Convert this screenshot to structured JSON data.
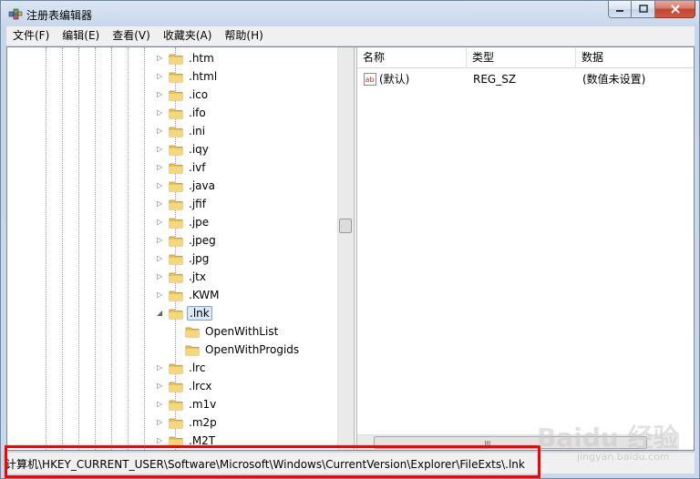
{
  "window": {
    "title": "注册表编辑器"
  },
  "menu": [
    "文件(F)",
    "编辑(E)",
    "查看(V)",
    "收藏夹(A)",
    "帮助(H)"
  ],
  "tree": {
    "items": [
      {
        "label": ".htm",
        "level": 0,
        "expander": "▷"
      },
      {
        "label": ".html",
        "level": 0,
        "expander": "▷"
      },
      {
        "label": ".ico",
        "level": 0,
        "expander": "▷"
      },
      {
        "label": ".ifo",
        "level": 0,
        "expander": "▷"
      },
      {
        "label": ".ini",
        "level": 0,
        "expander": "▷"
      },
      {
        "label": ".iqy",
        "level": 0,
        "expander": "▷"
      },
      {
        "label": ".ivf",
        "level": 0,
        "expander": "▷"
      },
      {
        "label": ".java",
        "level": 0,
        "expander": "▷"
      },
      {
        "label": ".jfif",
        "level": 0,
        "expander": "▷"
      },
      {
        "label": ".jpe",
        "level": 0,
        "expander": "▷"
      },
      {
        "label": ".jpeg",
        "level": 0,
        "expander": "▷"
      },
      {
        "label": ".jpg",
        "level": 0,
        "expander": "▷"
      },
      {
        "label": ".jtx",
        "level": 0,
        "expander": "▷"
      },
      {
        "label": ".KWM",
        "level": 0,
        "expander": "▷"
      },
      {
        "label": ".lnk",
        "level": 0,
        "expander": "◢",
        "selected": true
      },
      {
        "label": "OpenWithList",
        "level": 1,
        "expander": ""
      },
      {
        "label": "OpenWithProgids",
        "level": 1,
        "expander": ""
      },
      {
        "label": ".lrc",
        "level": 0,
        "expander": "▷"
      },
      {
        "label": ".lrcx",
        "level": 0,
        "expander": "▷"
      },
      {
        "label": ".m1v",
        "level": 0,
        "expander": "▷"
      },
      {
        "label": ".m2p",
        "level": 0,
        "expander": "▷"
      },
      {
        "label": ".M2T",
        "level": 0,
        "expander": "▷"
      }
    ]
  },
  "list": {
    "columns": [
      "名称",
      "类型",
      "数据"
    ],
    "rows": [
      {
        "name": "(默认)",
        "type": "REG_SZ",
        "data": "(数值未设置)"
      }
    ],
    "icon_label": "ab"
  },
  "status": {
    "path": "计算机\\HKEY_CURRENT_USER\\Software\\Microsoft\\Windows\\CurrentVersion\\Explorer\\FileExts\\.lnk"
  },
  "watermark": {
    "text": "Baidu 经验",
    "sub": "jingyan.baidu.com"
  },
  "colors": {
    "highlight": "#ff0000",
    "folder": "#e8c15a",
    "selection": "#dbe8f7"
  }
}
